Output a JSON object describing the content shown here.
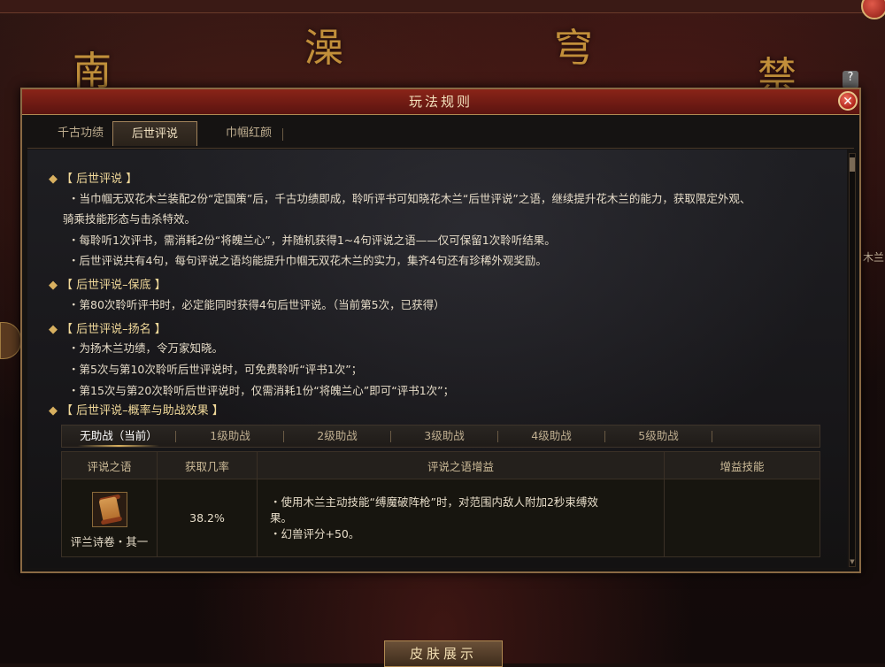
{
  "background": {
    "glyphs": [
      "南",
      "澡",
      "穹",
      "禁"
    ],
    "bottom_button": "皮肤展示",
    "side_label": "木兰",
    "help_icon": "?"
  },
  "dialog": {
    "title": "玩法规则",
    "tabs": [
      "千古功绩",
      "后世评说",
      "巾帼红颜"
    ],
    "active_tab": "后世评说"
  },
  "sections": [
    {
      "heading": "【 后世评说 】",
      "lines": [
        "・当巾帼无双花木兰装配2份“定国策”后，千古功绩即成，聆听评书可知晓花木兰“后世评说”之语，继续提升花木兰的能力，获取限定外观、",
        "骑乘技能形态与击杀特效。",
        "・每聆听1次评书，需消耗2份“将魄兰心”，并随机获得1~4句评说之语——仅可保留1次聆听结果。",
        "・后世评说共有4句，每句评说之语均能提升巾帼无双花木兰的实力，集齐4句还有珍稀外观奖励。"
      ]
    },
    {
      "heading": "【 后世评说–保底 】",
      "lines": [
        "・第80次聆听评书时，必定能同时获得4句后世评说。（当前第5次，已获得）"
      ]
    },
    {
      "heading": "【 后世评说–扬名 】",
      "lines": [
        "・为扬木兰功绩，令万家知晓。",
        "・第5次与第10次聆听后世评说时，可免费聆听“评书1次”；",
        "・第15次与第20次聆听后世评说时，仅需消耗1份“将魄兰心”即可“评书1次”；"
      ]
    },
    {
      "heading": "【 后世评说–概率与助战效果 】",
      "lines": []
    }
  ],
  "levels": {
    "tabs": [
      "无助战（当前）",
      "1级助战",
      "2级助战",
      "3级助战",
      "4级助战",
      "5级助战"
    ],
    "active": "无助战（当前）"
  },
  "table": {
    "headers": [
      "评说之语",
      "获取几率",
      "评说之语增益",
      "增益技能"
    ],
    "rows": [
      {
        "item_name": "评兰诗卷・其一",
        "icon": "scroll-icon",
        "rate": "38.2%",
        "buff_lines": [
          "・使用木兰主动技能“缚魔破阵枪”时，对范围内敌人附加2秒束缚效",
          "果。",
          "・幻兽评分+50。"
        ],
        "skill": ""
      }
    ]
  },
  "colors": {
    "titlebar": "#7a1e16",
    "border_gold": "#8a6a44",
    "heading_gold": "#f1d99a",
    "text": "#e6dcc8"
  }
}
